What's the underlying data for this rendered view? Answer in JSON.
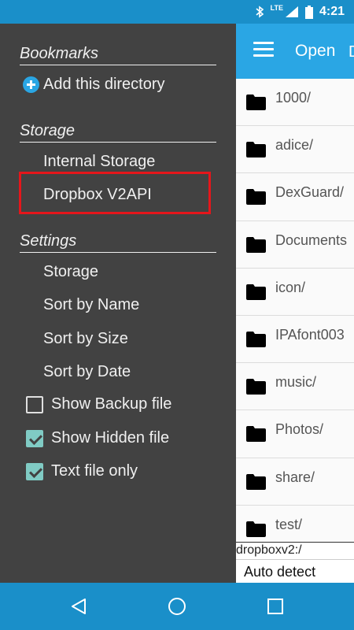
{
  "status_bar": {
    "time": "4:21",
    "network": "LTE",
    "icons": [
      "bluetooth-icon",
      "signal-icon",
      "battery-icon"
    ]
  },
  "toolbar": {
    "title": "Open",
    "extra": "D"
  },
  "drawer": {
    "bookmarks": {
      "header": "Bookmarks",
      "add_label": "Add this directory"
    },
    "storage": {
      "header": "Storage",
      "items": [
        "Internal Storage",
        "Dropbox V2API"
      ],
      "highlighted": "Dropbox V2API"
    },
    "settings": {
      "header": "Settings",
      "items": [
        "Storage",
        "Sort by Name",
        "Sort by Size",
        "Sort by Date"
      ],
      "checkboxes": [
        {
          "label": "Show Backup file",
          "checked": false
        },
        {
          "label": "Show Hidden file",
          "checked": true
        },
        {
          "label": "Text file only",
          "checked": true
        }
      ]
    }
  },
  "files": [
    "1000/",
    "adice/",
    "DexGuard/",
    "Documents",
    "icon/",
    "IPAfont003",
    "music/",
    "Photos/",
    "share/",
    "test/"
  ],
  "path": "dropboxv2:/",
  "encoding": "Auto detect",
  "colors": {
    "accent": "#2aa6e4",
    "status_bar": "#1a8fc9",
    "drawer_bg": "#424242",
    "checkbox": "#80cbc4",
    "highlight": "#e5161b"
  }
}
